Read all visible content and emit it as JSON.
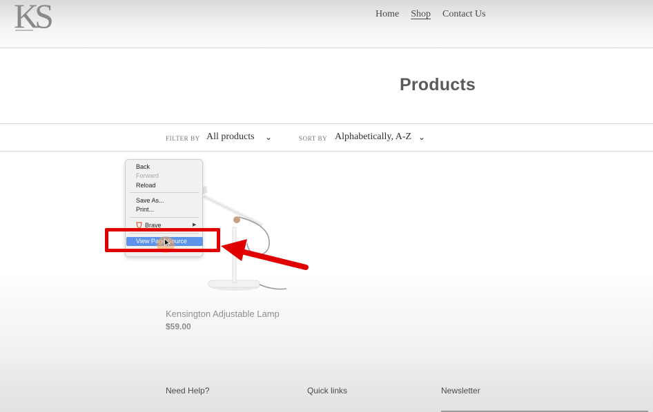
{
  "header": {
    "logo_text": "KS",
    "nav": [
      {
        "label": "Home"
      },
      {
        "label": "Shop"
      },
      {
        "label": "Contact Us"
      }
    ]
  },
  "page": {
    "title": "Products"
  },
  "filters": {
    "filter_label": "FILTER BY",
    "filter_value": "All products",
    "sort_label": "SORT BY",
    "sort_value": "Alphabetically, A-Z"
  },
  "product": {
    "name": "Kensington Adjustable Lamp",
    "price": "$59.00"
  },
  "context_menu": {
    "items": [
      {
        "label": "Back",
        "enabled": true
      },
      {
        "label": "Forward",
        "enabled": false
      },
      {
        "label": "Reload",
        "enabled": true
      },
      {
        "label": "Save As...",
        "enabled": true
      },
      {
        "label": "Print...",
        "enabled": true
      },
      {
        "label": "Brave",
        "enabled": true
      },
      {
        "label": "View Page Source",
        "enabled": true,
        "highlighted": true
      }
    ]
  },
  "footer": {
    "columns": [
      {
        "title": "Need Help?"
      },
      {
        "title": "Quick links"
      },
      {
        "title": "Newsletter"
      }
    ]
  },
  "colors": {
    "annotation": "#e00000",
    "menu_highlight": "#5d93e8"
  }
}
